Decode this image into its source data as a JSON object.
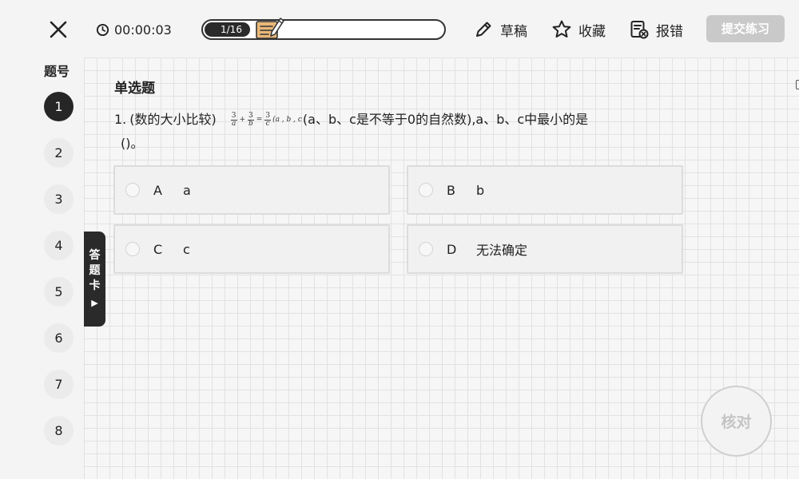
{
  "header": {
    "close_icon": "close-icon",
    "timer": {
      "icon": "clock-icon",
      "value": "00:00:03"
    },
    "progress": {
      "current": 1,
      "total": 16,
      "label": "1/16",
      "fraction": 0.0625,
      "knob_icon": "notes-pencil-icon"
    },
    "tools": [
      {
        "id": "draft",
        "label": "草稿",
        "icon": "pencil-icon"
      },
      {
        "id": "favorite",
        "label": "收藏",
        "icon": "star-icon"
      },
      {
        "id": "report",
        "label": "报错",
        "icon": "report-error-icon"
      }
    ],
    "submit_label": "提交练习"
  },
  "sidebar": {
    "title": "题号",
    "numbers": [
      "1",
      "2",
      "3",
      "4",
      "5",
      "6",
      "7",
      "8"
    ],
    "active_index": 0,
    "answer_card_label": [
      "答",
      "题",
      "卡"
    ],
    "answer_card_arrow": "▶"
  },
  "question": {
    "type_label": "单选题",
    "number": "1.",
    "prefix": "(数的大小比较)",
    "formula": {
      "terms": [
        {
          "num": "3",
          "den": "a"
        },
        {
          "num": "3",
          "den": "b"
        },
        {
          "num": "3",
          "den": "c"
        }
      ],
      "plus": "+",
      "equals": "=",
      "tail": "(a , b , c"
    },
    "text_after_formula": "(a、b、c是不等于0的自然数),a、b、c中最小的是",
    "text_line2": "()。",
    "options": [
      {
        "letter": "A",
        "text": "a"
      },
      {
        "letter": "B",
        "text": "b"
      },
      {
        "letter": "C",
        "text": "c"
      },
      {
        "letter": "D",
        "text": "无法确定"
      }
    ]
  },
  "check_label": "核对",
  "colors": {
    "accent_dark": "#262626",
    "submit_disabled": "#c9c9c9",
    "grid_line": "#e2e2e2"
  }
}
